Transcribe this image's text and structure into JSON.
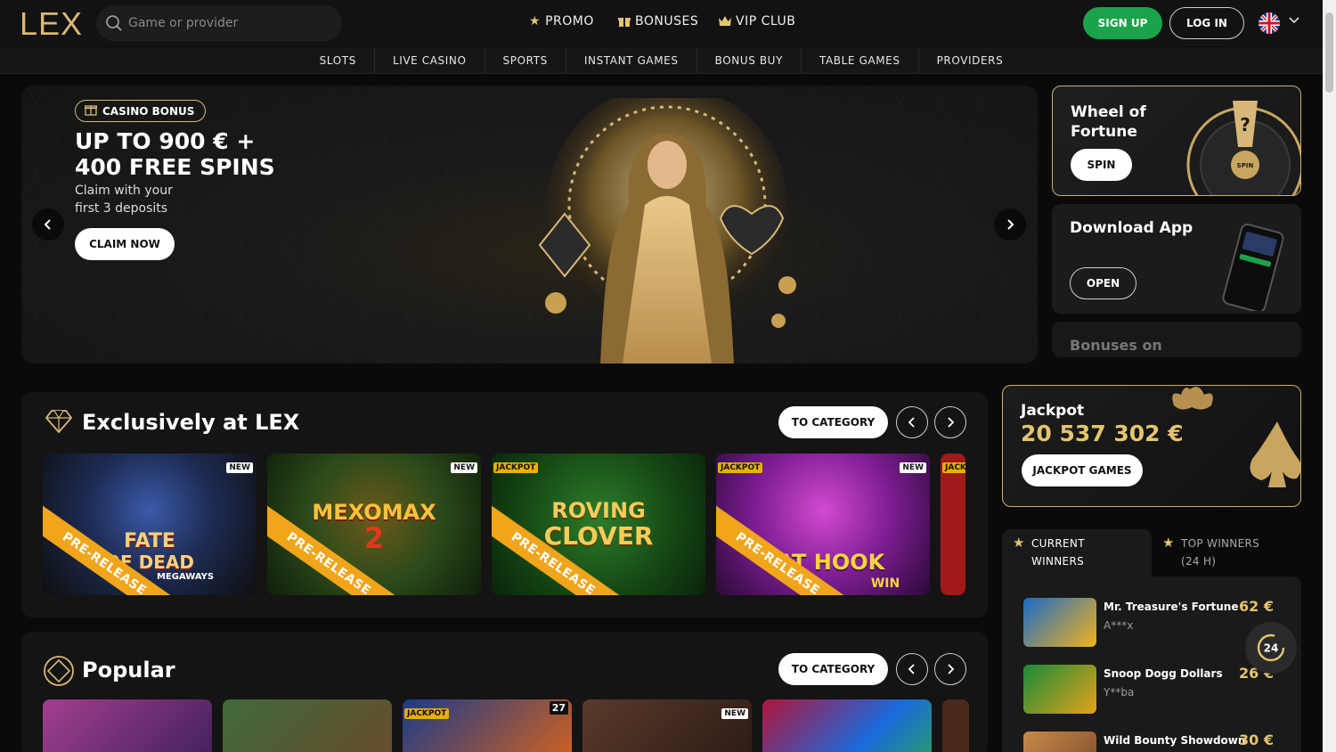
{
  "header": {
    "logo": "LEX",
    "search_placeholder": "Game or provider",
    "nav": [
      {
        "label": "PROMO",
        "icon": "star-icon"
      },
      {
        "label": "BONUSES",
        "icon": "gift-icon"
      },
      {
        "label": "VIP CLUB",
        "icon": "crown-icon"
      }
    ],
    "signup_label": "SIGN UP",
    "login_label": "LOG IN",
    "language_icon": "uk-flag-icon"
  },
  "categories": [
    "SLOTS",
    "LIVE CASINO",
    "SPORTS",
    "INSTANT GAMES",
    "BONUS BUY",
    "TABLE GAMES",
    "PROVIDERS"
  ],
  "hero": {
    "badge": "CASINO BONUS",
    "title_line1": "UP TO 900 € +",
    "title_line2": "400 FREE SPINS",
    "subtitle_line1": "Claim with your",
    "subtitle_line2": "first 3 deposits",
    "cta": "CLAIM NOW"
  },
  "promos": {
    "wheel": {
      "title_line1": "Wheel of",
      "title_line2": "Fortune",
      "button": "SPIN",
      "wheel_center": "SPIN",
      "wheel_mark": "?"
    },
    "app": {
      "title": "Download App",
      "button": "OPEN"
    },
    "bonuses": {
      "title": "Bonuses on"
    }
  },
  "exclusive": {
    "title": "Exclusively at LEX",
    "to_category": "TO CATEGORY",
    "games": [
      {
        "name_top": "FATE",
        "name_mid": "OF DEAD",
        "name_sub": "MEGAWAYS",
        "badge_new": "NEW",
        "ribbon": "PRE-RELEASE"
      },
      {
        "name_top": "MEXOMAX",
        "name_mid": "2",
        "badge_new": "NEW",
        "ribbon": "PRE-RELEASE"
      },
      {
        "name_top": "ROVING",
        "name_mid": "CLOVER",
        "badge_jp": "JACKPOT",
        "ribbon": "PRE-RELEASE"
      },
      {
        "name_top": "CAT HOOK",
        "name_mid": "WIN",
        "badge_jp": "JACKPOT",
        "badge_new": "NEW",
        "ribbon": "PRE-RELEASE"
      },
      {
        "badge_jp": "JACK"
      }
    ]
  },
  "popular": {
    "title": "Popular",
    "to_category": "TO CATEGORY",
    "badges": {
      "jackpot": "JACKPOT",
      "new": "NEW",
      "count": "27"
    }
  },
  "jackpot": {
    "label": "Jackpot",
    "amount": "20 537 302 €",
    "button": "JACKPOT GAMES"
  },
  "winners": {
    "tab_current_line1": "CURRENT",
    "tab_current_line2": "WINNERS",
    "tab_top_line1": "TOP WINNERS",
    "tab_top_line2": "(24 H)",
    "rows": [
      {
        "game": "Mr. Treasure's Fortune",
        "user": "A***x",
        "amount": "62 €"
      },
      {
        "game": "Snoop Dogg Dollars",
        "user": "Y**ba",
        "amount": "26 €"
      },
      {
        "game": "Wild Bounty Showdown",
        "user": "",
        "amount": "30 €"
      }
    ],
    "support_label": "24"
  },
  "colors": {
    "gold": "#d8b778",
    "green": "#1aa34a",
    "orange": "#f0a51a"
  }
}
